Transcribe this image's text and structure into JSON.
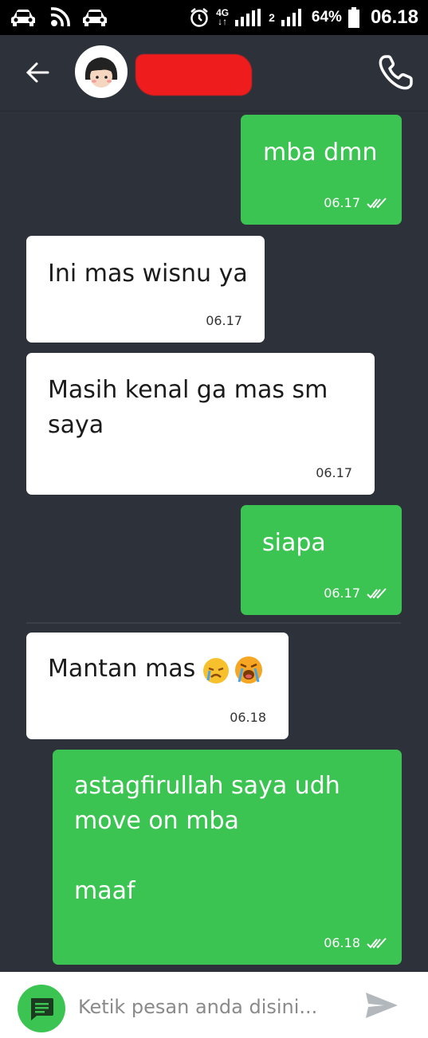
{
  "status_bar": {
    "network": "4G",
    "sim2_label": "2",
    "battery": "64%",
    "time": "06.18",
    "icons": [
      "car-icon",
      "wifi-hotspot-icon",
      "car-icon",
      "alarm-icon",
      "signal-icon",
      "signal-icon",
      "battery-icon"
    ]
  },
  "header": {
    "contact_name": "",
    "icons": [
      "back-arrow-icon",
      "avatar-icon",
      "phone-icon"
    ]
  },
  "messages": [
    {
      "direction": "out",
      "text": "mba dmn",
      "time": "06.17",
      "status": "double-check-icon"
    },
    {
      "direction": "in",
      "text": "Ini mas wisnu ya",
      "time": "06.17"
    },
    {
      "direction": "in",
      "text": "Masih kenal ga mas sm\nsaya",
      "time": "06.17"
    },
    {
      "direction": "out",
      "text": "siapa",
      "time": "06.17",
      "status": "double-check-icon"
    },
    {
      "direction": "in",
      "text": "Mantan mas",
      "emoji": [
        "crying-face-emoji",
        "loudly-crying-face-emoji"
      ],
      "time": "06.18"
    },
    {
      "direction": "out",
      "text": "astagfirullah saya udh\nmove on mba\n\nmaaf",
      "time": "06.18",
      "status": "double-check-icon"
    }
  ],
  "input_bar": {
    "placeholder": "Ketik pesan anda disini...",
    "value": "",
    "icons": [
      "chat-icon",
      "send-icon"
    ]
  },
  "colors": {
    "background": "#2d323a",
    "outgoing_bubble": "#3cc452",
    "incoming_bubble": "#ffffff",
    "redaction": "#ee1c1c"
  }
}
